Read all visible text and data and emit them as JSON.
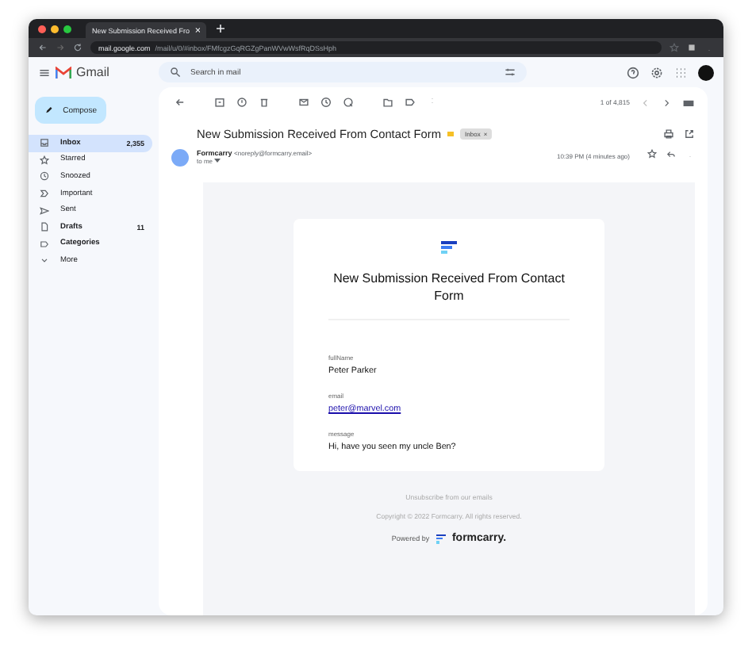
{
  "browser": {
    "tab_title": "New Submission Received Fro",
    "url_host": "mail.google.com",
    "url_path": "/mail/u/0/#inbox/FMfcgzGqRGZgPanWVwWsfRqDSsHph"
  },
  "gmail": {
    "app_name": "Gmail",
    "search": {
      "placeholder": "Search in mail"
    },
    "compose": "Compose",
    "sidebar": [
      {
        "label": "Inbox",
        "count": "2,355",
        "selected": true,
        "bold": true
      },
      {
        "label": "Starred",
        "selected": false,
        "bold": false
      },
      {
        "label": "Snoozed",
        "selected": false,
        "bold": false
      },
      {
        "label": "Important",
        "selected": false,
        "bold": false
      },
      {
        "label": "Sent",
        "selected": false,
        "bold": false
      },
      {
        "label": "Drafts",
        "count": "11",
        "selected": false,
        "bold": true
      },
      {
        "label": "Categories",
        "selected": false,
        "bold": true
      },
      {
        "label": "More",
        "selected": false,
        "bold": false
      }
    ],
    "pager": "1 of 4,815"
  },
  "email": {
    "subject": "New Submission Received From Contact Form",
    "label": "Inbox",
    "label_close": "×",
    "sender": "Formcarry",
    "sender_address": "<noreply@formcarry.email>",
    "recipient": "to me",
    "time": "10:39 PM (4 minutes ago)"
  },
  "form": {
    "title": "New Submission Received From Contact Form",
    "fields": [
      {
        "label": "fullName",
        "value": "Peter Parker",
        "kind": "text"
      },
      {
        "label": "email",
        "value": "peter@marvel.com",
        "kind": "link"
      },
      {
        "label": "message",
        "value": "Hi, have you seen my uncle Ben?",
        "kind": "text"
      }
    ],
    "unsubscribe": "Unsubscribe from our emails",
    "copyright": "Copyright © 2022 Formcarry. All rights reserved.",
    "powered_by": "Powered by",
    "brand": "formcarry."
  }
}
